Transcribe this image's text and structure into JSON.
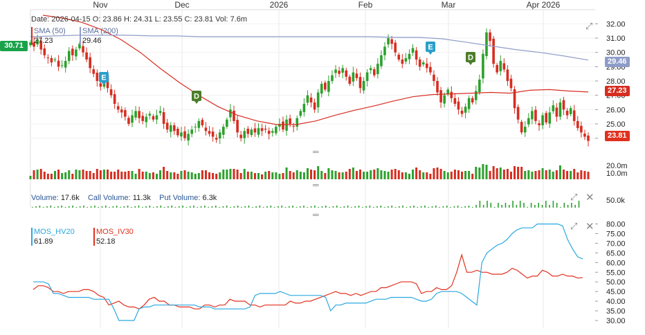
{
  "ohlc": {
    "date_label": "Date:",
    "date": "2026-04-15",
    "o_label": "O:",
    "o": "23.86",
    "h_label": "H:",
    "h": "24.31",
    "l_label": "L:",
    "l": "23.55",
    "c_label": "C:",
    "c": "23.81",
    "vol_label": "Vol:",
    "vol": "7.6m"
  },
  "sma_legend": [
    {
      "name": "SMA (50)",
      "value": "27.23",
      "color": "#d62d20"
    },
    {
      "name": "SMA (200)",
      "value": "29.46",
      "color": "#8e9cc8"
    }
  ],
  "left_tag": "30.71",
  "price_tags": {
    "sma200": "29.46",
    "sma50": "27.23",
    "last": "23.81"
  },
  "volume_legend": {
    "volume_label": "Volume:",
    "volume": "17.6k",
    "call_label": "Call Volume:",
    "call": "11.3k",
    "put_label": "Put Volume:",
    "put": "6.3k"
  },
  "iv_legend": [
    {
      "name": "MOS_HV20",
      "value": "61.89",
      "color": "#29a8e0"
    },
    {
      "name": "MOS_IV30",
      "value": "52.18",
      "color": "#e0301e"
    }
  ],
  "events": [
    {
      "letter": "E",
      "type": "earnings"
    },
    {
      "letter": "D",
      "type": "dividend"
    },
    {
      "letter": "E",
      "type": "earnings"
    },
    {
      "letter": "D",
      "type": "dividend"
    }
  ],
  "icons": {
    "expand": "expand-icon",
    "close": "close-icon",
    "handle": "drag-handle-icon"
  },
  "chart_data": [
    {
      "type": "candlestick",
      "x_ticks": [
        "Nov",
        "Dec",
        "2026",
        "Feb",
        "Mar",
        "Apr 2026"
      ],
      "y_ticks": [
        "32.00",
        "31.00",
        "30.00",
        "29.00",
        "28.00",
        "27.00",
        "26.00",
        "25.00",
        "24.00"
      ],
      "ylim": [
        23.4,
        32.6
      ],
      "close": [
        30.7,
        30.4,
        30.9,
        30.2,
        29.8,
        29.6,
        29.3,
        29.5,
        29.0,
        29.1,
        29.4,
        30.1,
        29.8,
        30.2,
        30.6,
        30.0,
        29.5,
        28.9,
        28.5,
        28.0,
        27.6,
        28.2,
        27.5,
        27.0,
        26.4,
        26.0,
        25.8,
        25.5,
        25.0,
        25.6,
        25.9,
        25.4,
        25.2,
        25.5,
        25.7,
        25.3,
        25.6,
        25.9,
        25.0,
        24.6,
        24.9,
        24.5,
        24.2,
        24.4,
        24.0,
        24.3,
        24.6,
        24.8,
        25.2,
        24.9,
        24.5,
        24.3,
        24.1,
        23.9,
        24.4,
        24.8,
        25.3,
        26.0,
        25.2,
        24.4,
        24.0,
        24.5,
        24.3,
        24.6,
        24.4,
        24.7,
        24.5,
        24.6,
        24.3,
        24.5,
        24.8,
        25.0,
        24.6,
        25.3,
        25.0,
        24.8,
        25.4,
        25.9,
        26.4,
        27.0,
        26.5,
        26.0,
        27.2,
        27.8,
        27.4,
        28.0,
        28.4,
        28.8,
        28.5,
        28.9,
        28.3,
        27.8,
        28.6,
        28.2,
        27.5,
        28.0,
        28.6,
        28.9,
        28.4,
        29.2,
        29.8,
        30.4,
        31.0,
        30.6,
        30.0,
        29.5,
        29.2,
        29.6,
        29.9,
        30.3,
        29.5,
        29.0,
        29.3,
        28.9,
        28.6,
        28.0,
        27.2,
        26.5,
        27.0,
        27.4,
        26.8,
        26.4,
        26.0,
        25.7,
        26.2,
        26.8,
        26.5,
        27.3,
        28.1,
        29.9,
        31.4,
        30.8,
        29.2,
        28.6,
        29.4,
        28.8,
        28.0,
        27.5,
        26.1,
        25.3,
        24.4,
        24.8,
        25.4,
        25.9,
        25.2,
        24.9,
        25.6,
        25.1,
        25.8,
        26.3,
        25.5,
        26.5,
        26.0,
        25.6,
        26.1,
        25.2,
        24.7,
        24.4,
        24.1,
        23.81
      ],
      "sma50": [
        32.6,
        32.4,
        32.1,
        31.6,
        30.9,
        30.0,
        28.9,
        27.9,
        27.0,
        26.2,
        25.6,
        25.2,
        24.95,
        24.95,
        25.2,
        25.6,
        25.95,
        26.25,
        26.6,
        26.9,
        27.05,
        27.1,
        27.15,
        27.2,
        27.15,
        27.35,
        27.4,
        27.3,
        27.23
      ],
      "sma200": [
        31.1,
        31.15,
        31.2,
        31.2,
        31.2,
        31.15,
        31.15,
        31.1,
        31.1,
        31.1,
        31.1,
        31.1,
        31.1,
        31.1,
        31.1,
        31.05,
        31.05,
        30.95,
        30.7,
        30.45,
        30.2,
        30.0,
        29.75,
        29.46
      ],
      "volume_ylabels": [
        "20.0m",
        "10.0m"
      ]
    },
    {
      "type": "bar",
      "name": "Options volume",
      "y_ticks": [
        "50.0k"
      ]
    },
    {
      "type": "line",
      "series": [
        {
          "name": "MOS_HV20",
          "values": [
            50,
            50,
            50,
            49,
            44,
            44,
            43,
            42,
            42,
            42,
            42,
            42,
            41,
            41,
            41,
            41,
            36,
            30,
            30,
            30,
            30,
            36,
            37,
            37,
            38,
            38,
            38,
            38,
            38,
            38,
            38,
            38,
            38,
            37,
            37,
            37,
            36,
            36,
            36,
            36,
            36,
            36,
            36,
            37,
            43,
            44,
            44,
            44,
            44,
            45,
            44,
            43,
            43,
            43,
            43,
            43,
            43,
            43,
            42,
            35,
            38,
            38,
            39,
            39,
            39,
            39,
            39,
            40,
            41,
            41,
            41,
            42,
            42,
            42,
            42,
            42,
            41,
            40,
            40,
            41,
            44,
            45,
            45,
            45,
            45,
            44,
            42,
            40,
            38,
            60,
            65,
            67,
            69,
            70,
            72,
            75,
            77,
            78,
            78,
            78,
            80,
            80,
            80,
            80,
            80,
            79,
            72,
            67,
            63,
            61.89
          ]
        },
        {
          "name": "MOS_IV30",
          "values": [
            46,
            48,
            48,
            47,
            45,
            45,
            44,
            45,
            45,
            45,
            46,
            46,
            45,
            43,
            42,
            38,
            39,
            40,
            38,
            37,
            37,
            36,
            38,
            41,
            42,
            40,
            40,
            38,
            38,
            37,
            37,
            37,
            36,
            36,
            38,
            38,
            37,
            38,
            38,
            41,
            40,
            40,
            40,
            38,
            38,
            37,
            38,
            38,
            38,
            38,
            38,
            40,
            39,
            39,
            40,
            40,
            41,
            42,
            43,
            44,
            45,
            44,
            44,
            43,
            44,
            43,
            44,
            45,
            45,
            47,
            47,
            48,
            49,
            50,
            50,
            50,
            49,
            44,
            45,
            45,
            47,
            46,
            46,
            48,
            55,
            64,
            55,
            55,
            56,
            55,
            55,
            54,
            54,
            54,
            55,
            57,
            56,
            54,
            52,
            53,
            53,
            56,
            55,
            53,
            53,
            54,
            53,
            53,
            52,
            52.18
          ]
        }
      ],
      "y_ticks": [
        "80.00",
        "75.00",
        "70.00",
        "65.00",
        "60.00",
        "55.00",
        "50.00",
        "45.00",
        "40.00",
        "35.00",
        "30.00"
      ],
      "ylim": [
        27.5,
        82
      ]
    }
  ]
}
